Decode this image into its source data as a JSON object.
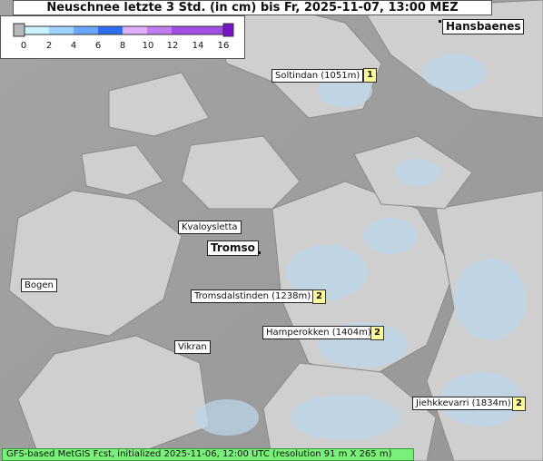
{
  "title": "Neuschnee letzte 3 Std. (in cm) bis Fr, 2025-11-07, 13:00 MEZ",
  "legend": {
    "colors": [
      "#b8b8b8",
      "#c9f4ff",
      "#9ed2ff",
      "#6ba6ff",
      "#2f6df0",
      "#e0b0ff",
      "#c07cf0",
      "#a24de6",
      "#7a12c8"
    ],
    "ticks": [
      "0",
      "2",
      "4",
      "6",
      "8",
      "10",
      "12",
      "14",
      "16"
    ]
  },
  "places": {
    "hansbaenes": "Hansbaenes",
    "soltindan": "Soltindan (1051m)",
    "soltindan_value": "1",
    "kvaloysletta": "Kvaloysletta",
    "tromso": "Tromso",
    "bogen": "Bogen",
    "tromsdalstinden": "Tromsdalstinden (1238m)",
    "tromsdalstinden_value": "2",
    "hamperokken": "Hamperokken (1404m)",
    "hamperokken_value": "2",
    "vikran": "Vikran",
    "jiehkkevarri": "Jiehkkevarri (1834m)",
    "jiehkkevarri_value": "2"
  },
  "footer": "GFS-based MetGIS Fcst, initialized 2025-11-06, 12:00 UTC  (resolution 91 m X 265 m)"
}
